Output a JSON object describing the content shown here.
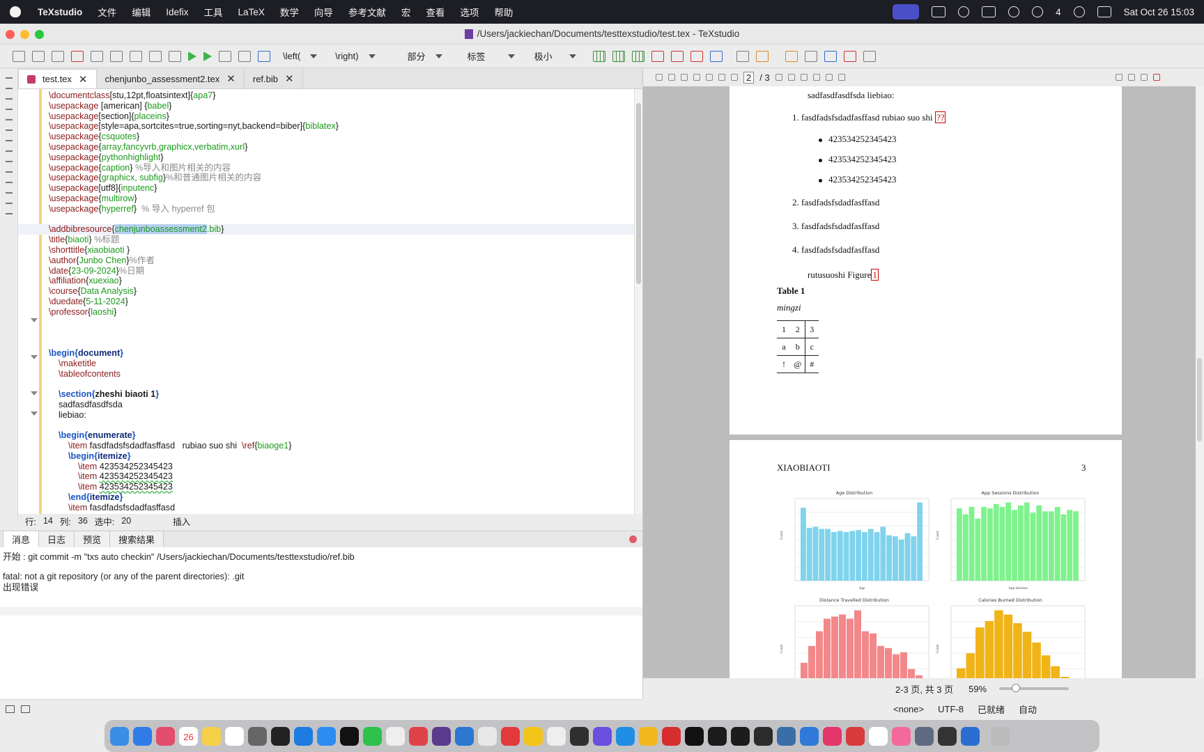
{
  "menubar": {
    "app": "TeXstudio",
    "items": [
      "文件",
      "编辑",
      "Idefix",
      "工具",
      "LaTeX",
      "数学",
      "向导",
      "参考文献",
      "宏",
      "查看",
      "选项",
      "帮助"
    ],
    "badge": "4",
    "clock": "Sat Oct 26  15:03"
  },
  "window": {
    "title": "/Users/jackiechan/Documents/testtexstudio/test.tex - TeXstudio"
  },
  "toolbar": {
    "left_delim": "\\left(",
    "right_delim": "\\right)",
    "section": "部分",
    "label": "标签",
    "size": "极小"
  },
  "tabs": [
    "test.tex",
    "chenjunbo_assessment2.tex",
    "ref.bib"
  ],
  "editor": {
    "lines": [
      "\\documentclass[stu,12pt,floatsintext]{apa7}",
      "\\usepackage [american] {babel}",
      "\\usepackage[section]{placeins}",
      "\\usepackage[style=apa,sortcites=true,sorting=nyt,backend=biber]{biblatex}",
      "\\usepackage{csquotes}",
      "\\usepackage{array,fancyvrb,graphicx,verbatim,xurl}",
      "\\usepackage{pythonhighlight}",
      "\\usepackage{caption} %导入和图片相关的内容",
      "\\usepackage{graphicx, subfig}%和普通图片相关的内容",
      "\\usepackage[utf8]{inputenc}",
      "\\usepackage{multirow}",
      "\\usepackage{hyperref}  % 导入 hyperref 包",
      "",
      "\\addbibresource{chenjunboassessment2.bib}",
      "\\title{biaoti} %标题",
      "\\shorttitle{xiaobiaoti }",
      "\\author{Junbo Chen}%作者",
      "\\date{23-09-2024}%日期",
      "\\affiliation{xuexiao}",
      "\\course{Data Analysis}",
      "\\duedate{5-11-2024}",
      "\\professor{laoshi}",
      "",
      "",
      "",
      "\\begin{document}",
      "    \\maketitle",
      "    \\tableofcontents",
      "",
      "    \\section{zheshi biaoti 1}",
      "    sadfasdfasdfsda",
      "    liebiao:",
      "",
      "    \\begin{enumerate}",
      "        \\item fasdfadsfsdadfasffasd   rubiao suo shi  \\ref{biaoge1}",
      "        \\begin{itemize}",
      "            \\item 423534252345423",
      "            \\item 423534252345423",
      "            \\item 423534252345423",
      "        \\end{itemize}",
      "        \\item fasdfadsfsdadfasffasd"
    ]
  },
  "editor_status": {
    "row_label": "行:",
    "row": "14",
    "col_label": "列:",
    "col": "36",
    "sel_label": "选中:",
    "sel": "20",
    "mode": "插入"
  },
  "messages": {
    "tabs": [
      "消息",
      "日志",
      "预览",
      "搜索结果"
    ],
    "lines": [
      "开始 : git commit -m \"txs auto checkin\" /Users/jackiechan/Documents/testtexstudio/ref.bib",
      "",
      "fatal: not a git repository (or any of the parent directories): .git",
      "出现错误"
    ]
  },
  "pdf": {
    "page_current": "2",
    "page_total": "/ 3",
    "page1": {
      "intro": "sadfasdfasdfsda liebiao:",
      "enum1": "1.  fasdfadsfsdadfasffasd rubiao suo shi",
      "ref_unresolved": "??",
      "bullets": [
        "423534252345423",
        "423534252345423",
        "423534252345423"
      ],
      "enum2": "2.  fasdfadsfsdadfasffasd",
      "enum3": "3.  fasdfadsfsdadfasffasd",
      "enum4": "4.  fasdfadsfsdadfasffasd",
      "figref": "rutusuoshi Figure",
      "figref_num": "1",
      "table_title": "Table 1",
      "table_caption": "mingzi",
      "table": [
        [
          "1",
          "2",
          "3"
        ],
        [
          "a",
          "b",
          "c"
        ],
        [
          "!",
          "@",
          "#"
        ]
      ]
    },
    "page2": {
      "header": "XIAOBIAOTI",
      "page_no": "3",
      "plots": [
        {
          "title": "Age Distribution",
          "xlabel": "Age",
          "ylabel": "Count",
          "color": "#7fd3ec",
          "values": [
            345,
            250,
            255,
            245,
            245,
            230,
            235,
            230,
            235,
            240,
            230,
            245,
            230,
            255,
            215,
            210,
            195,
            225,
            210,
            370
          ]
        },
        {
          "title": "App Sessions Distribution",
          "xlabel": "App Sessions",
          "ylabel": "Count",
          "color": "#7ef28c",
          "values": [
            245,
            225,
            250,
            210,
            250,
            245,
            260,
            250,
            265,
            240,
            255,
            265,
            230,
            255,
            235,
            235,
            250,
            225,
            240,
            235
          ]
        },
        {
          "title": "Distance Travelled Distribution",
          "xlabel": "",
          "ylabel": "Count",
          "color": "#f2888a",
          "values": [
            180,
            260,
            330,
            390,
            400,
            410,
            390,
            430,
            330,
            320,
            260,
            250,
            220,
            230,
            150,
            120
          ]
        },
        {
          "title": "Calories Burned Distribution",
          "xlabel": "",
          "ylabel": "Count",
          "color": "#f0b418",
          "values": [
            150,
            220,
            340,
            370,
            420,
            400,
            360,
            320,
            270,
            210,
            160,
            110,
            80
          ]
        }
      ]
    },
    "status": {
      "pages": "2-3 页, 共 3 页",
      "zoom": "59%"
    }
  },
  "bottom_status": {
    "dict": "<none>",
    "encoding": "UTF-8",
    "ready": "已就绪",
    "auto": "自动"
  },
  "dock": {
    "calendar_day": "26"
  }
}
